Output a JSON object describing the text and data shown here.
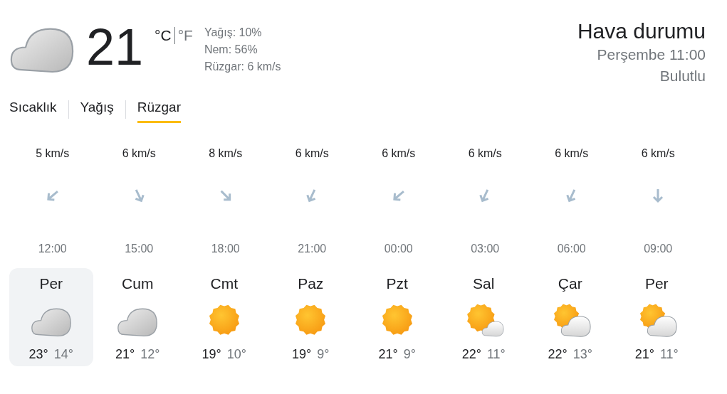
{
  "current": {
    "kind": "cloudy",
    "temperature": "21",
    "units": [
      {
        "label": "°C",
        "selected": true
      },
      {
        "label": "°F",
        "selected": false
      }
    ],
    "details": [
      "Yağış: 10%",
      "Nem: 56%",
      "Rüzgar: 6 km/s"
    ]
  },
  "summary": {
    "title": "Hava durumu",
    "time": "Perşembe 11:00",
    "condition": "Bulutlu"
  },
  "tabs": [
    {
      "label": "Sıcaklık",
      "selected": false
    },
    {
      "label": "Yağış",
      "selected": false
    },
    {
      "label": "Rüzgar",
      "selected": true
    }
  ],
  "wind": [
    {
      "speed": "5 km/s",
      "kind": "southwest",
      "time": "12:00"
    },
    {
      "speed": "6 km/s",
      "kind": "southsoutheast",
      "time": "15:00"
    },
    {
      "speed": "8 km/s",
      "kind": "southeast",
      "time": "18:00"
    },
    {
      "speed": "6 km/s",
      "kind": "southsouthwest",
      "time": "21:00"
    },
    {
      "speed": "6 km/s",
      "kind": "southwest",
      "time": "00:00"
    },
    {
      "speed": "6 km/s",
      "kind": "southsouthwest",
      "time": "03:00"
    },
    {
      "speed": "6 km/s",
      "kind": "southsouthwest",
      "time": "06:00"
    },
    {
      "speed": "6 km/s",
      "kind": "south",
      "time": "09:00"
    }
  ],
  "days": [
    {
      "day": "Per",
      "kind": "cloudy",
      "high": "23°",
      "low": "14°",
      "selected": true
    },
    {
      "day": "Cum",
      "kind": "cloudy",
      "high": "21°",
      "low": "12°",
      "selected": false
    },
    {
      "day": "Cmt",
      "kind": "sunny",
      "high": "19°",
      "low": "10°",
      "selected": false
    },
    {
      "day": "Paz",
      "kind": "sunny",
      "high": "19°",
      "low": "9°",
      "selected": false
    },
    {
      "day": "Pzt",
      "kind": "sunny",
      "high": "21°",
      "low": "9°",
      "selected": false
    },
    {
      "day": "Sal",
      "kind": "mostlysunny",
      "high": "22°",
      "low": "11°",
      "selected": false
    },
    {
      "day": "Çar",
      "kind": "partlycloudy",
      "high": "22°",
      "low": "13°",
      "selected": false
    },
    {
      "day": "Per",
      "kind": "partlycloudy",
      "high": "21°",
      "low": "11°",
      "selected": false
    }
  ]
}
